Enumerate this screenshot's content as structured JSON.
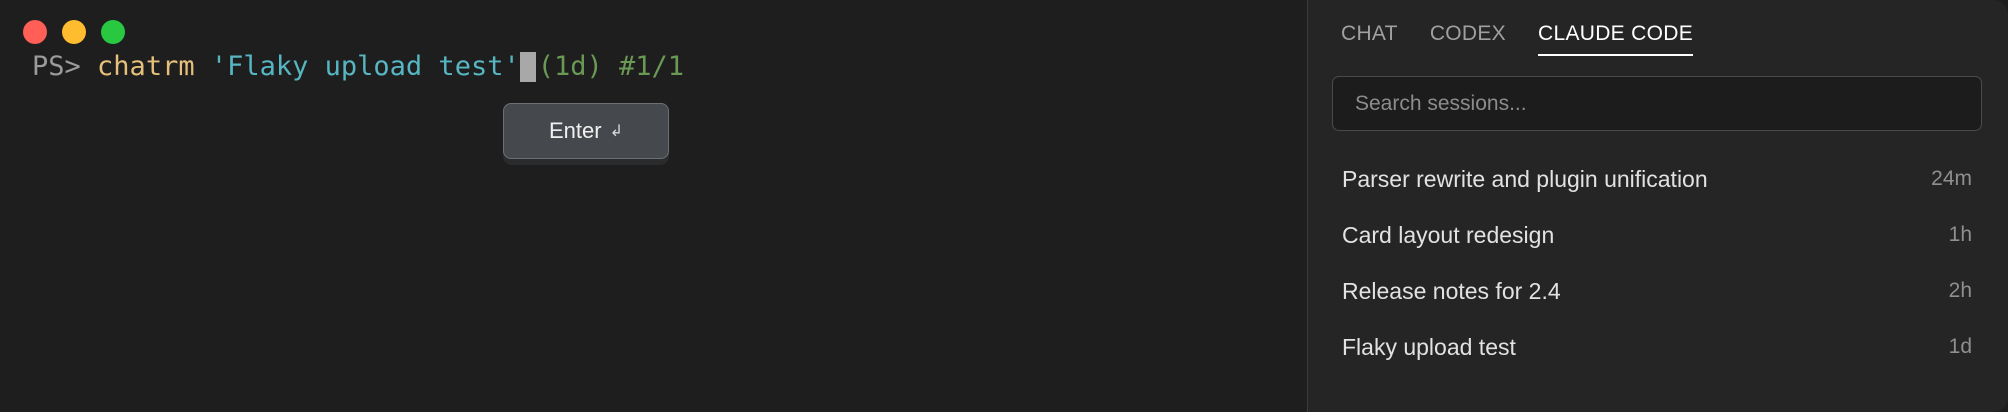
{
  "terminal": {
    "prompt": "PS>",
    "command": "chatrm",
    "argument": "'Flaky upload test'",
    "meta": "(1d) #1/1",
    "enter_label": "Enter",
    "enter_glyph": "↲"
  },
  "sidebar": {
    "tabs": [
      {
        "label": "CHAT",
        "active": false
      },
      {
        "label": "CODEX",
        "active": false
      },
      {
        "label": "CLAUDE CODE",
        "active": true
      }
    ],
    "search": {
      "placeholder": "Search sessions...",
      "value": ""
    },
    "sessions": [
      {
        "title": "Parser rewrite and plugin unification",
        "age": "24m"
      },
      {
        "title": "Card layout redesign",
        "age": "1h"
      },
      {
        "title": "Release notes for 2.4",
        "age": "2h"
      },
      {
        "title": "Flaky upload test",
        "age": "1d"
      }
    ]
  },
  "colors": {
    "window_bg": "#1e1e1e",
    "sidebar_bg": "#252526",
    "traffic_red": "#ff5f57",
    "traffic_yellow": "#febc2e",
    "traffic_green": "#28c840",
    "command": "#e5c07b",
    "argument": "#56b6c2",
    "meta": "#6a9955"
  }
}
